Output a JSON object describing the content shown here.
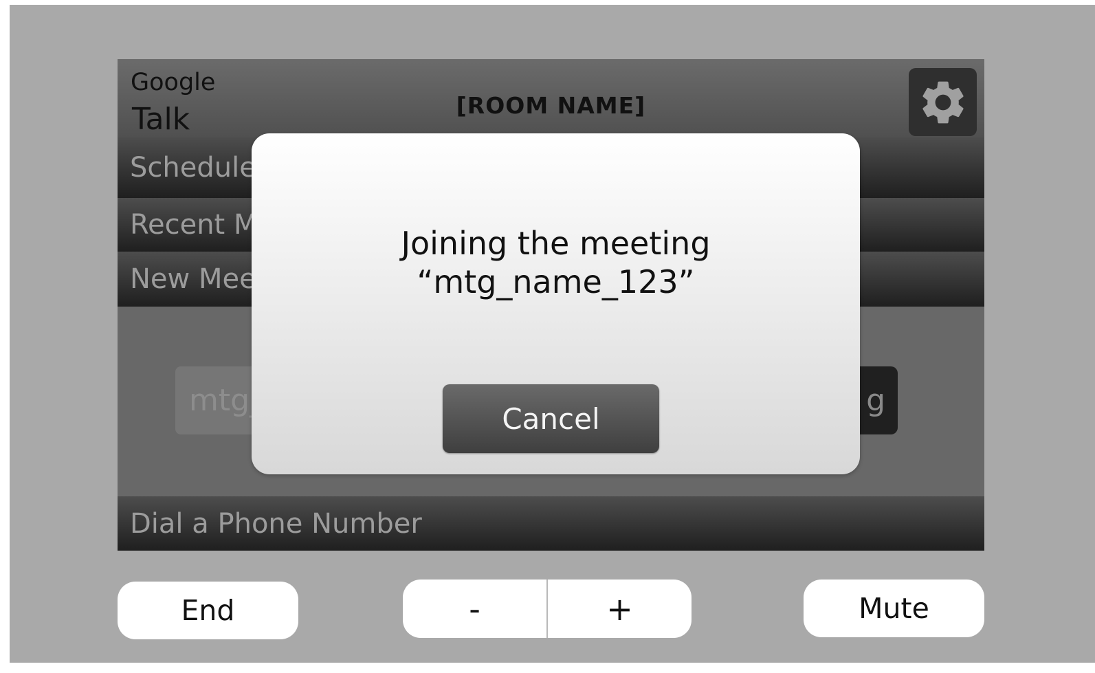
{
  "app": {
    "brand_line1": "Google",
    "brand_line2": "Talk",
    "room_name": "[ROOM NAME]",
    "settings_icon": "gear-icon"
  },
  "menu": {
    "items": [
      {
        "label": "Scheduled"
      },
      {
        "label": "Recent M"
      },
      {
        "label": "New Mee"
      },
      {
        "label": "Dial a Phone Number"
      }
    ]
  },
  "meeting_entry": {
    "value": "mtg_",
    "join_label": "g"
  },
  "dialog": {
    "message_line1": "Joining the meeting",
    "message_line2": "“mtg_name_123”",
    "cancel_label": "Cancel"
  },
  "controls": {
    "end_label": "End",
    "volume_down_label": "-",
    "volume_up_label": "+",
    "mute_label": "Mute"
  },
  "colors": {
    "background": "#a9a9a9",
    "screen": "#686868",
    "dialog": "#ffffff",
    "button_dark": "#4f4f4f"
  }
}
